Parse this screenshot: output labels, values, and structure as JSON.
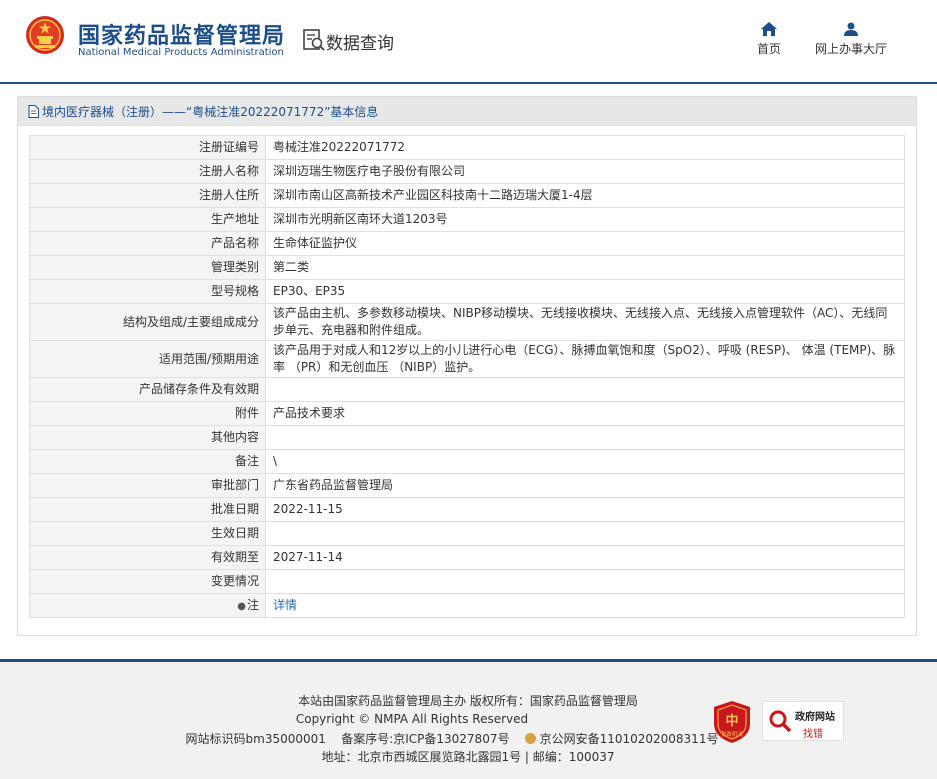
{
  "header": {
    "title_cn": "国家药品监督管理局",
    "title_en": "National Medical Products Administration",
    "query_label": "数据查询",
    "nav": {
      "home": "首页",
      "office": "网上办事大厅"
    }
  },
  "panel": {
    "heading": "境内医疗器械（注册）——“粤械注准20222071772”基本信息",
    "rows": [
      {
        "key": "注册证编号",
        "value": "粤械注准20222071772"
      },
      {
        "key": "注册人名称",
        "value": "深圳迈瑞生物医疗电子股份有限公司"
      },
      {
        "key": "注册人住所",
        "value": "深圳市南山区高新技术产业园区科技南十二路迈瑞大厦1-4层"
      },
      {
        "key": "生产地址",
        "value": "深圳市光明新区南环大道1203号"
      },
      {
        "key": "产品名称",
        "value": "生命体征监护仪"
      },
      {
        "key": "管理类别",
        "value": "第二类"
      },
      {
        "key": "型号规格",
        "value": "EP30、EP35"
      },
      {
        "key": "结构及组成/主要组成成分",
        "value": "该产品由主机、多参数移动模块、NIBP移动模块、无线接收模块、无线接入点、无线接入点管理软件（AC）、无线同步单元、充电器和附件组成。"
      },
      {
        "key": "适用范围/预期用途",
        "value": "该产品用于对成人和12岁以上的小儿进行心电（ECG）、脉搏血氧饱和度（SpO2）、呼吸 (RESP)、 体温 (TEMP)、脉率 （PR）和无创血压 （NIBP）监护。"
      },
      {
        "key": "产品储存条件及有效期",
        "value": ""
      },
      {
        "key": "附件",
        "value": "产品技术要求"
      },
      {
        "key": "其他内容",
        "value": ""
      },
      {
        "key": "备注",
        "value": "\\"
      },
      {
        "key": "审批部门",
        "value": "广东省药品监督管理局"
      },
      {
        "key": "批准日期",
        "value": "2022-11-15"
      },
      {
        "key": "生效日期",
        "value": ""
      },
      {
        "key": "有效期至",
        "value": "2027-11-14"
      },
      {
        "key": "变更情况",
        "value": ""
      }
    ],
    "note_key": "注",
    "note_link": "详情"
  },
  "footer": {
    "line1": "本站由国家药品监督管理局主办 版权所有：国家药品监督管理局",
    "line2": "Copyright © NMPA All Rights Reserved",
    "site_id": "网站标识码bm35000001",
    "icp": "备案序号:京ICP备13027807号",
    "police": "京公网安备11010202008311号",
    "address": "地址：北京市西城区展览路北露园1号 | 邮编：100037",
    "badge_gov_line1": "政府网站",
    "badge_gov_line2": "找错",
    "badge_red_text": "党政机关"
  }
}
